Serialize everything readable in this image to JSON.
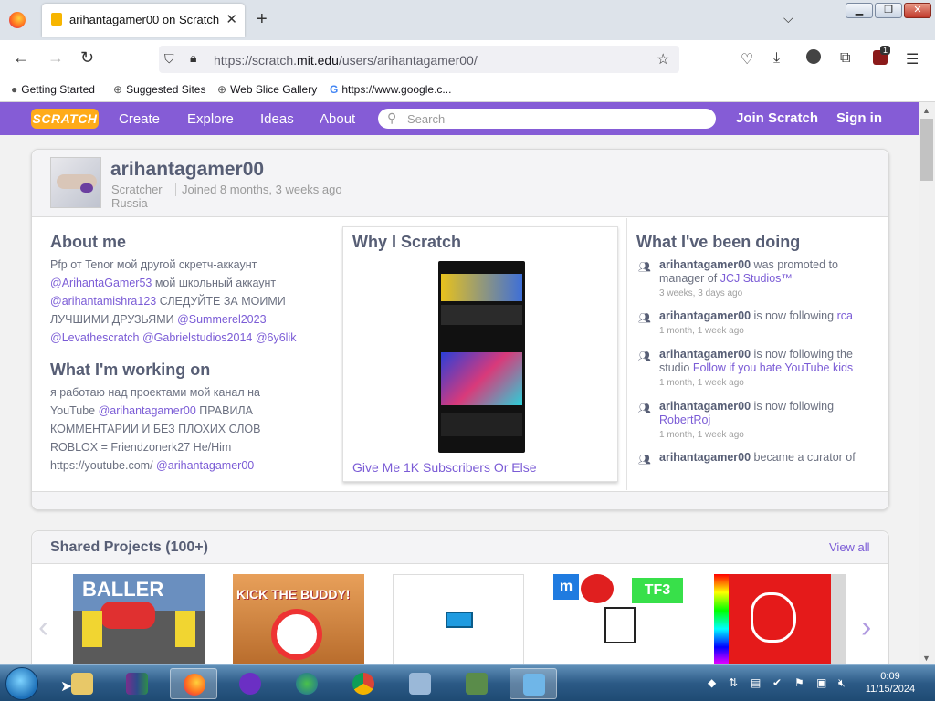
{
  "browser": {
    "tab_title": "arihantagamer00 on Scratch",
    "new_tab_label": "+",
    "tab_list_label": "⌵",
    "url_prefix": "https://scratch.",
    "url_domain": "mit.edu",
    "url_path": "/users/arihantagamer00/",
    "bookmarks": [
      "Getting Started",
      "Suggested Sites",
      "Web Slice Gallery",
      "https://www.google.c..."
    ],
    "extension_badge": "1"
  },
  "scratch_nav": {
    "logo": "SCRATCH",
    "links": [
      "Create",
      "Explore",
      "Ideas",
      "About"
    ],
    "search_placeholder": "Search",
    "join": "Join Scratch",
    "signin": "Sign in"
  },
  "profile": {
    "username": "arihantagamer00",
    "role": "Scratcher",
    "joined": "Joined 8 months, 3 weeks ago",
    "country": "Russia"
  },
  "about": {
    "title": "About me",
    "t1": "Pfp от Tenor мой другой скретч-аккаунт ",
    "l1": "@ArihantaGamer53",
    "t2": " мой школьный аккаунт ",
    "l2": "@arihantamishra123",
    "t3": " СЛЕДУЙТЕ ЗА МОИМИ ЛУЧШИМИ ДРУЗЬЯМИ ",
    "l3": "@Summerel2023",
    "l4": "@Levathescratch",
    "l5": "@Gabrielstudios2014",
    "l6": "@6y6lik"
  },
  "working": {
    "title": "What I'm working on",
    "t1": "я работаю над проектами мой канал на YouTube ",
    "l1": "@arihantagamer00",
    "t2": " ПРАВИЛА КОММЕНТАРИИ И БЕЗ ПЛОХИХ СЛОВ ROBLOX = Friendzonerk27 He/Him https://youtube.com/ ",
    "l2": "@arihantagamer00"
  },
  "why": {
    "title": "Why I Scratch",
    "caption": "Give Me 1K Subscribers Or Else"
  },
  "activity": {
    "title": "What I've been doing",
    "items": [
      {
        "user": "arihantagamer00",
        "text": " was promoted to manager of ",
        "link": "JCJ Studios™",
        "time": "3 weeks, 3 days ago"
      },
      {
        "user": "arihantagamer00",
        "text": " is now following ",
        "link": "rca",
        "time": "1 month, 1 week ago"
      },
      {
        "user": "arihantagamer00",
        "text": " is now following the studio ",
        "link": "Follow if you hate YouTube kids",
        "time": "1 month, 1 week ago"
      },
      {
        "user": "arihantagamer00",
        "text": " is now following ",
        "link": "RobertRoj",
        "time": "1 month, 1 week ago"
      },
      {
        "user": "arihantagamer00",
        "text": " became a curator of",
        "link": "",
        "time": ""
      }
    ]
  },
  "shared": {
    "title": "Shared Projects (100+)",
    "view_all": "View all",
    "thumb1_text": "BALLER",
    "thumb2_text": "KICK THE BUDDY!",
    "thumb4_text": "TF3"
  },
  "taskbar": {
    "time": "0:09",
    "date": "11/15/2024"
  },
  "colors": {
    "scratch_purple": "#855cd6",
    "link": "#7b5cd6",
    "text": "#575e75"
  }
}
